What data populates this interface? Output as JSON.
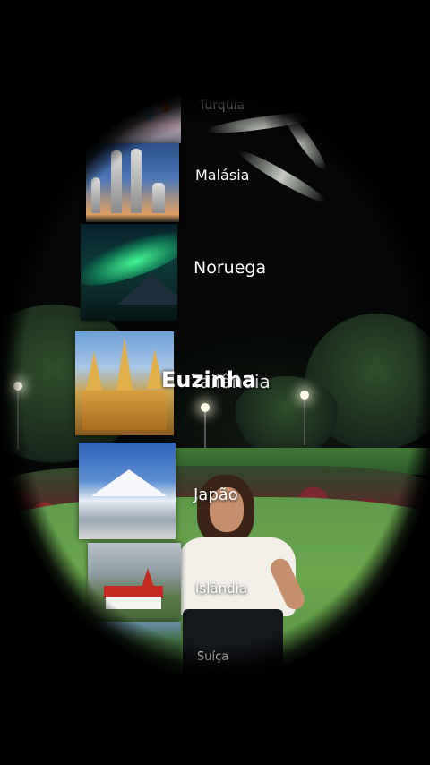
{
  "overlay": {
    "name": "Euzinha"
  },
  "destinations": [
    {
      "label": "Turquia"
    },
    {
      "label": "Malásia"
    },
    {
      "label": "Noruega"
    },
    {
      "label": "Tailândia"
    },
    {
      "label": "Japão"
    },
    {
      "label": "Islândia"
    },
    {
      "label": "Suíça"
    }
  ],
  "colors": {
    "label_text": "#ffffff",
    "lawn": "#6ba84f",
    "aurora": "#46ff96",
    "church_roof": "#c22a22"
  }
}
